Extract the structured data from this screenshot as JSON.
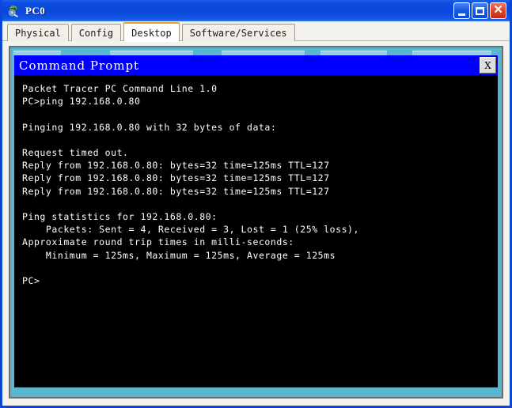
{
  "window": {
    "title": "PC0",
    "icon": "packet-tracer-pc-icon",
    "controls": {
      "minimize_label": "Minimize",
      "maximize_label": "Maximize",
      "close_label": "Close"
    }
  },
  "tabs": [
    {
      "label": "Physical",
      "active": false
    },
    {
      "label": "Config",
      "active": false
    },
    {
      "label": "Desktop",
      "active": true
    },
    {
      "label": "Software/Services",
      "active": false
    }
  ],
  "command_prompt": {
    "title": "Command Prompt",
    "close_label": "X",
    "lines": [
      "Packet Tracer PC Command Line 1.0",
      "PC>ping 192.168.0.80",
      "",
      "Pinging 192.168.0.80 with 32 bytes of data:",
      "",
      "Request timed out.",
      "Reply from 192.168.0.80: bytes=32 time=125ms TTL=127",
      "Reply from 192.168.0.80: bytes=32 time=125ms TTL=127",
      "Reply from 192.168.0.80: bytes=32 time=125ms TTL=127",
      "",
      "Ping statistics for 192.168.0.80:",
      "    Packets: Sent = 4, Received = 3, Lost = 1 (25% loss),",
      "Approximate round trip times in milli-seconds:",
      "    Minimum = 125ms, Maximum = 125ms, Average = 125ms",
      "",
      "PC>"
    ]
  },
  "colors": {
    "title_bar_blue": "#0a45d8",
    "cmd_frame_cyan": "#58b6ce",
    "cmd_title_blue": "#0000ff",
    "terminal_bg": "#000000",
    "terminal_fg": "#ffffff",
    "active_tab_accent": "#f0a020",
    "panel_bg": "#f4f2ec",
    "close_button_red": "#c22d10"
  }
}
